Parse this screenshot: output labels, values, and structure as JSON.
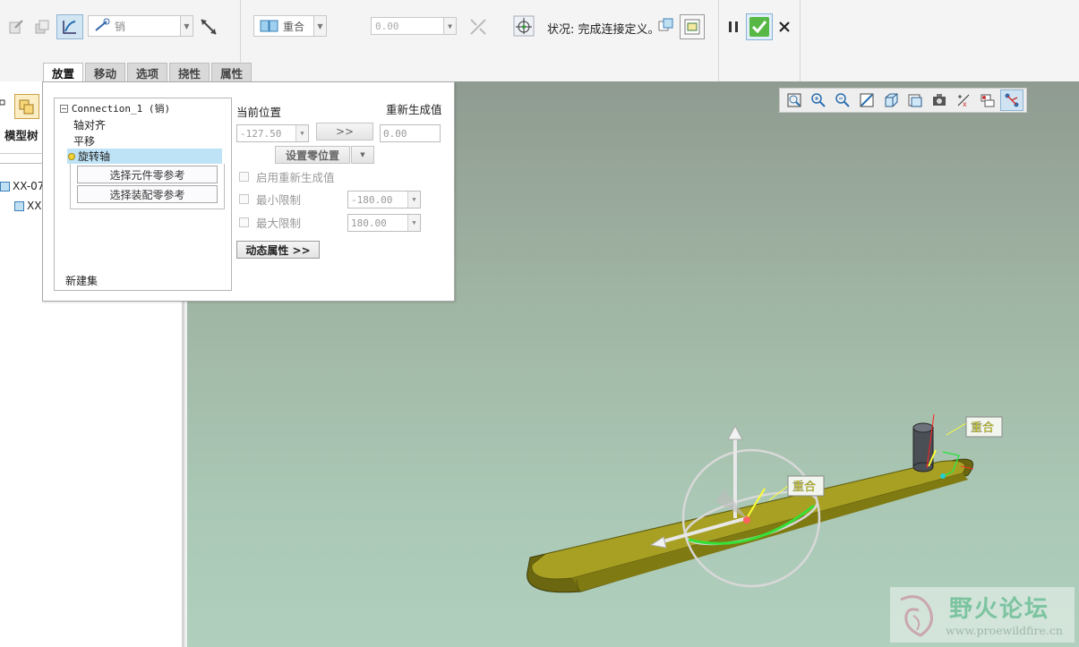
{
  "ribbon": {
    "connection_type": "销",
    "constraint_type": "重合",
    "offset_value": "0.00",
    "status_label": "状况:",
    "status_value": "完成连接定义。"
  },
  "tabs": [
    {
      "label": "放置",
      "active": true
    },
    {
      "label": "移动",
      "active": false
    },
    {
      "label": "选项",
      "active": false
    },
    {
      "label": "挠性",
      "active": false
    },
    {
      "label": "属性",
      "active": false
    }
  ],
  "left_pane": {
    "title": "模型树",
    "items": [
      "XX-07-",
      "XX"
    ]
  },
  "placement": {
    "connection": "Connection_1 (销)",
    "constraints": [
      "轴对齐",
      "平移",
      "旋转轴"
    ],
    "selected_constraint": "旋转轴",
    "ref_component": "选择元件零参考",
    "ref_assembly": "选择装配零参考",
    "new_set": "新建集",
    "current_position_label": "当前位置",
    "current_position_value": "-127.50",
    "transfer_button": ">>",
    "regen_value_label": "重新生成值",
    "regen_value": "0.00",
    "set_zero_button": "设置零位置",
    "enable_regen_label": "启用重新生成值",
    "min_limit_label": "最小限制",
    "min_limit_value": "-180.00",
    "max_limit_label": "最大限制",
    "max_limit_value": "180.00",
    "dynamic_props_button": "动态属性  >>"
  },
  "viewport": {
    "constraint_tag_1": "重合",
    "constraint_tag_2": "重合"
  },
  "watermark": {
    "title": "野火论坛",
    "url": "www.proewildfire.cn"
  },
  "colors": {
    "part_body": "#7f7a12",
    "part_top": "#a7a022",
    "tag_text": "#ffff00",
    "accent_check": "#3aa52d",
    "selection": "#bfe3f6"
  }
}
